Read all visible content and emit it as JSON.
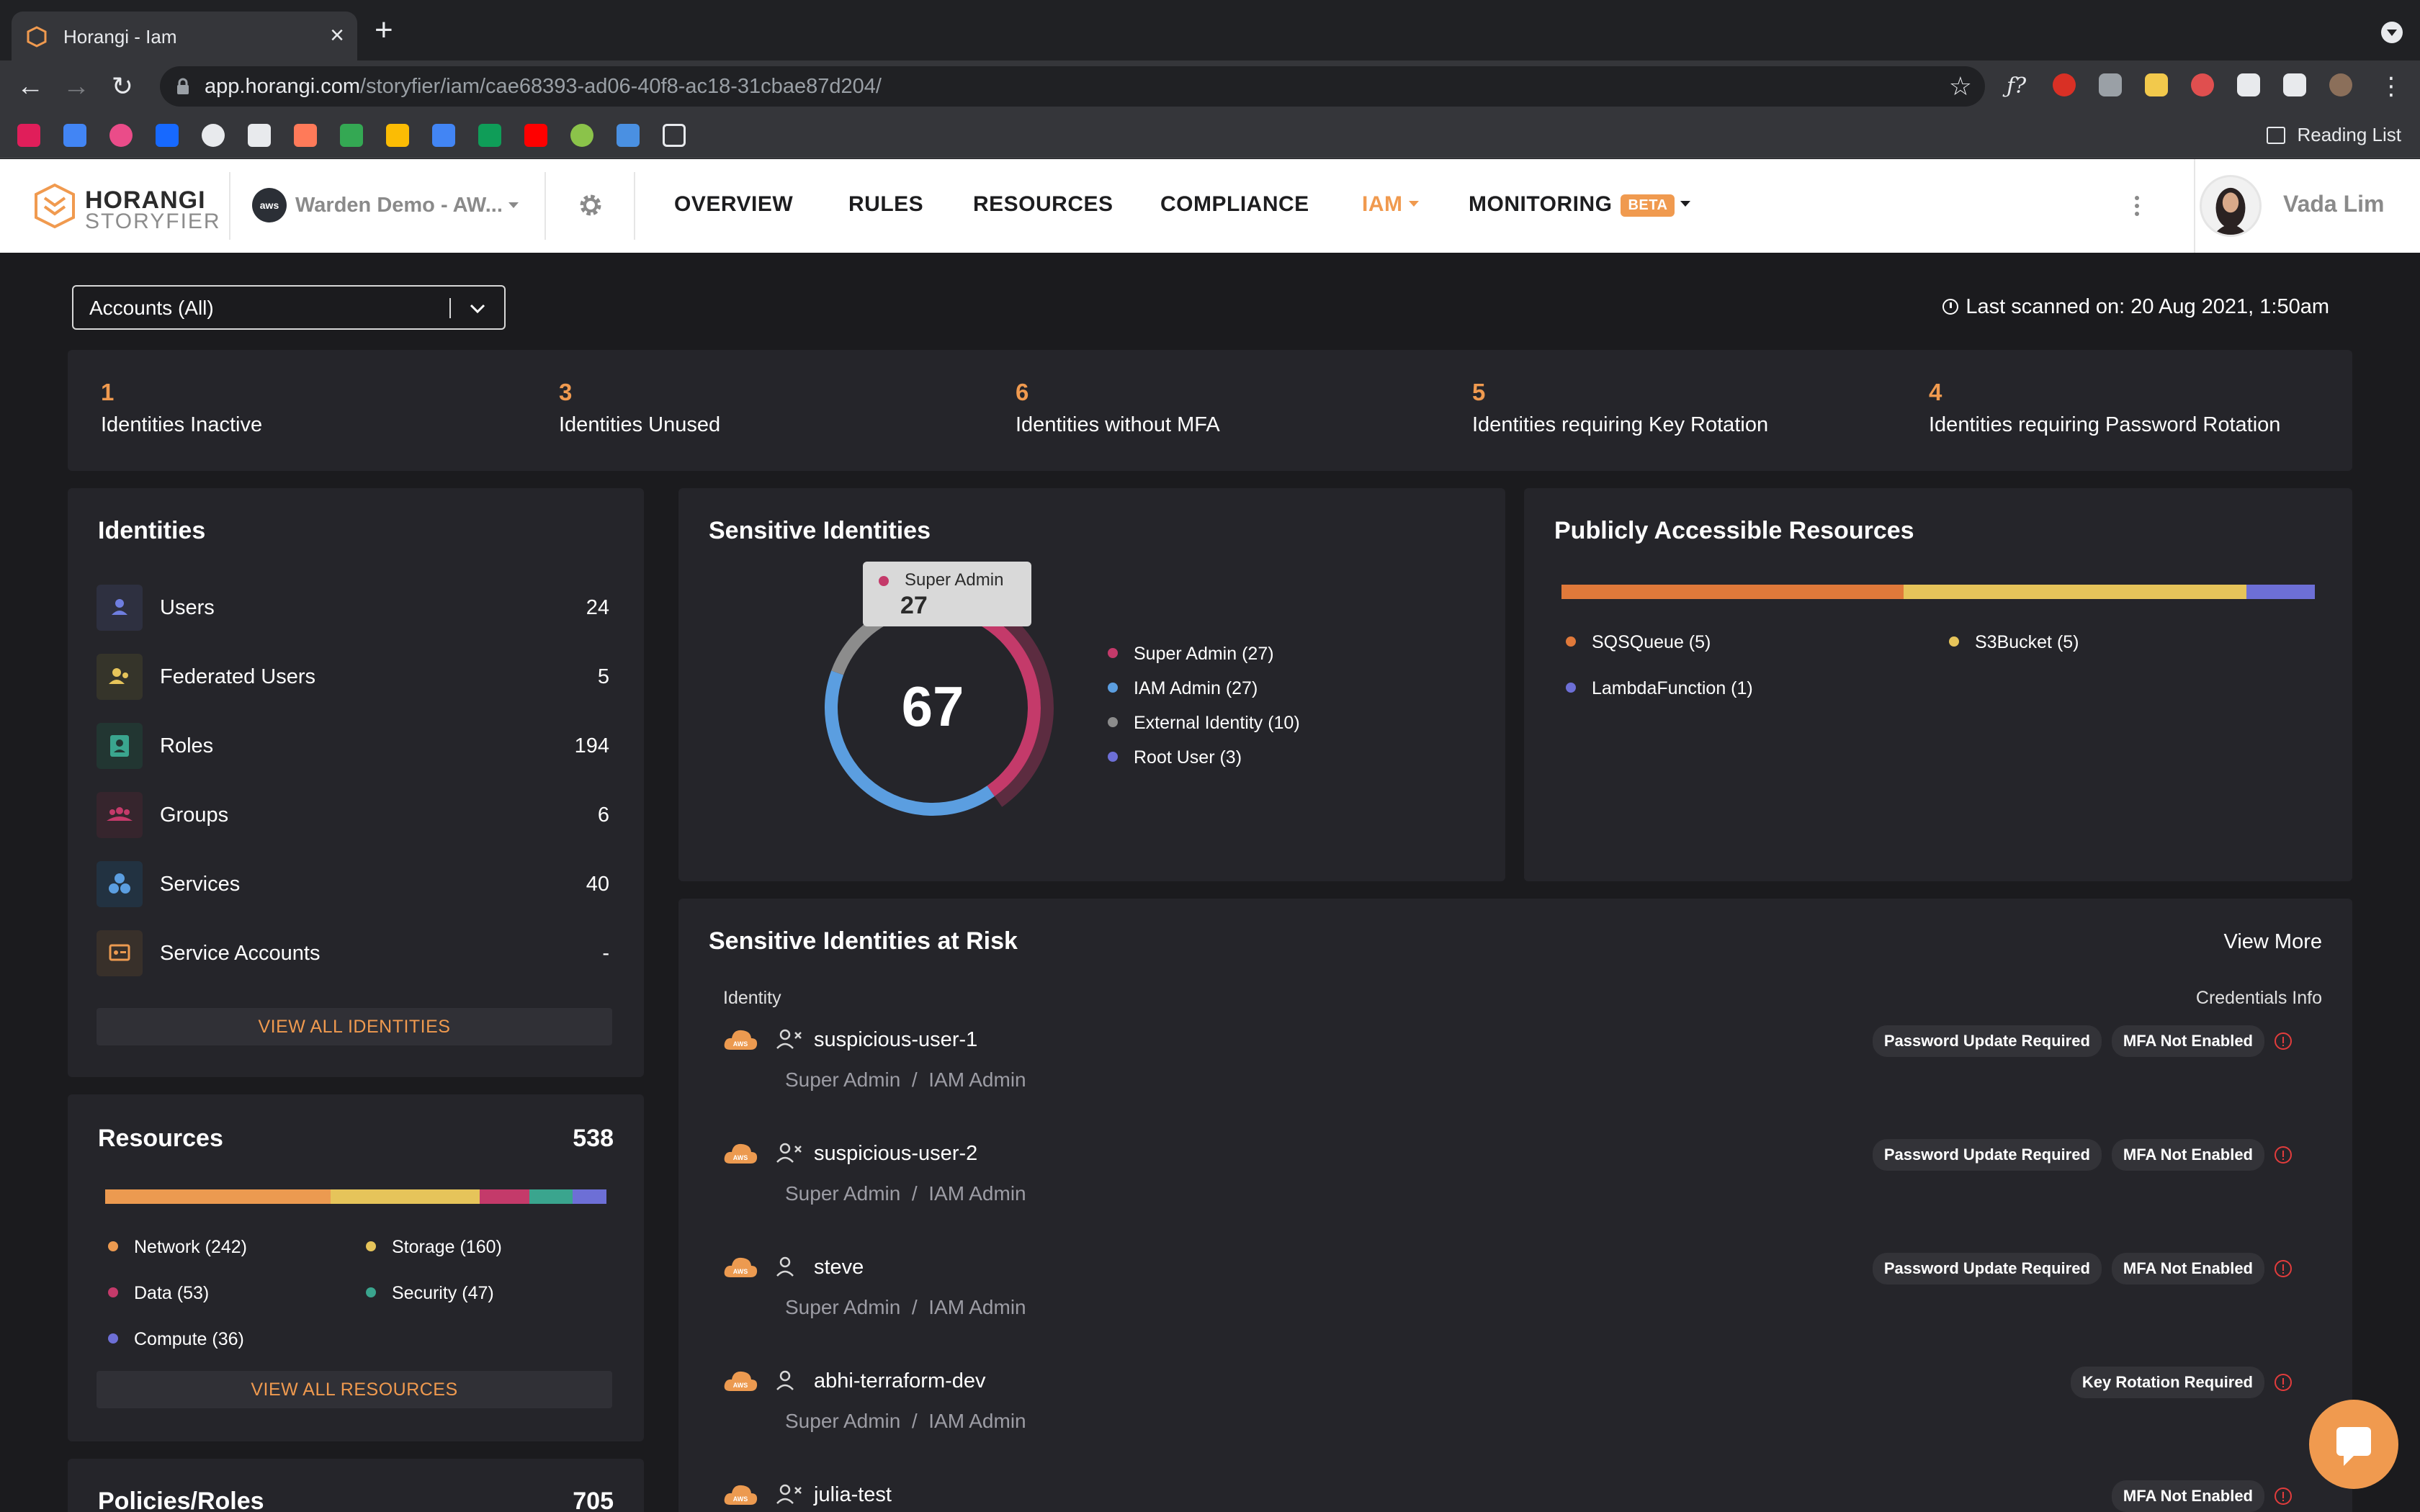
{
  "browser": {
    "tab_title": "Horangi - Iam",
    "url_host": "app.horangi.com",
    "url_path": "/storyfier/iam/cae68393-ad06-40f8-ac18-31cbae87d204/",
    "reading_list": "Reading List"
  },
  "header": {
    "logo_name": "HORANGI",
    "logo_sub": "STORYFIER",
    "aws_badge": "aws",
    "account": "Warden Demo - AW...",
    "nav": [
      "OVERVIEW",
      "RULES",
      "RESOURCES",
      "COMPLIANCE",
      "IAM",
      "MONITORING"
    ],
    "beta": "BETA",
    "user_name": "Vada Lim"
  },
  "filter": {
    "accounts": "Accounts (All)",
    "last_scanned": "Last scanned on: 20 Aug 2021, 1:50am"
  },
  "stats": [
    {
      "value": "1",
      "label": "Identities Inactive"
    },
    {
      "value": "3",
      "label": "Identities Unused"
    },
    {
      "value": "6",
      "label": "Identities without MFA"
    },
    {
      "value": "5",
      "label": "Identities requiring Key Rotation"
    },
    {
      "value": "4",
      "label": "Identities requiring Password Rotation"
    }
  ],
  "identities": {
    "title": "Identities",
    "items": [
      {
        "label": "Users",
        "count": "24"
      },
      {
        "label": "Federated Users",
        "count": "5"
      },
      {
        "label": "Roles",
        "count": "194"
      },
      {
        "label": "Groups",
        "count": "6"
      },
      {
        "label": "Services",
        "count": "40"
      },
      {
        "label": "Service Accounts",
        "count": "-"
      }
    ],
    "view_all": "VIEW ALL IDENTITIES"
  },
  "resources": {
    "title": "Resources",
    "total": "538",
    "segments": [
      {
        "label": "Network (242)",
        "value": 242,
        "color": "#ec9a50"
      },
      {
        "label": "Storage (160)",
        "value": 160,
        "color": "#e6c45a"
      },
      {
        "label": "Data (53)",
        "value": 53,
        "color": "#c43a6a"
      },
      {
        "label": "Security (47)",
        "value": 47,
        "color": "#3aa58e"
      },
      {
        "label": "Compute (36)",
        "value": 36,
        "color": "#6d6fd6"
      }
    ],
    "view_all": "VIEW ALL RESOURCES"
  },
  "policies": {
    "title": "Policies/Roles",
    "total": "705"
  },
  "sensitive": {
    "title": "Sensitive Identities",
    "total": "67",
    "tooltip": {
      "name": "Super Admin",
      "value": "27"
    },
    "segments": [
      {
        "label": "Super Admin (27)",
        "value": 27,
        "color": "#c43a6a"
      },
      {
        "label": "IAM Admin (27)",
        "value": 27,
        "color": "#5b9ee0"
      },
      {
        "label": "External Identity (10)",
        "value": 10,
        "color": "#8c8c8c"
      },
      {
        "label": "Root User (3)",
        "value": 3,
        "color": "#6d6fd6"
      }
    ]
  },
  "public": {
    "title": "Publicly Accessible Resources",
    "segments": [
      {
        "label": "SQSQueue (5)",
        "value": 5,
        "color": "#e0793a"
      },
      {
        "label": "S3Bucket (5)",
        "value": 5,
        "color": "#e6c45a"
      },
      {
        "label": "LambdaFunction (1)",
        "value": 1,
        "color": "#6d6fd6"
      }
    ]
  },
  "at_risk": {
    "title": "Sensitive Identities at Risk",
    "view_more": "View More",
    "col_identity": "Identity",
    "col_creds": "Credentials Info",
    "aws_label": "AWS",
    "rows": [
      {
        "name": "suspicious-user-1",
        "role1": "Super Admin",
        "sep": "/",
        "role2": "IAM Admin",
        "badges": [
          "Password Update Required",
          "MFA Not Enabled"
        ]
      },
      {
        "name": "suspicious-user-2",
        "role1": "Super Admin",
        "sep": "/",
        "role2": "IAM Admin",
        "badges": [
          "Password Update Required",
          "MFA Not Enabled"
        ]
      },
      {
        "name": "steve",
        "role1": "Super Admin",
        "sep": "/",
        "role2": "IAM Admin",
        "badges": [
          "Password Update Required",
          "MFA Not Enabled"
        ]
      },
      {
        "name": "abhi-terraform-dev",
        "role1": "Super Admin",
        "sep": "/",
        "role2": "IAM Admin",
        "badges": [
          "Key Rotation Required"
        ]
      },
      {
        "name": "julia-test",
        "role1": "",
        "sep": "",
        "role2": "",
        "badges": [
          "MFA Not Enabled"
        ]
      }
    ]
  }
}
